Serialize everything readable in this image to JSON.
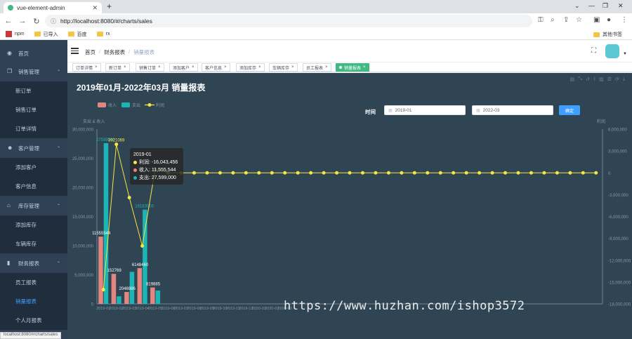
{
  "browser": {
    "tab_title": "vue-element-admin",
    "url": "http://localhost:8080/#/charts/sales",
    "status_url": "localhost:8080/#/charts/sales",
    "bookmarks": [
      "npm",
      "已导入",
      "百度",
      "rx"
    ],
    "other_bookmarks": "其他书签"
  },
  "sidebar": {
    "items": [
      {
        "label": "首页",
        "icon": "dashboard-icon",
        "type": "item"
      },
      {
        "label": "销售管理",
        "icon": "copy-icon",
        "type": "group"
      },
      {
        "label": "新订单",
        "type": "sub"
      },
      {
        "label": "销售订单",
        "type": "sub"
      },
      {
        "label": "订单详情",
        "type": "sub"
      },
      {
        "label": "客户管理",
        "icon": "people-icon",
        "type": "group"
      },
      {
        "label": "添加客户",
        "type": "sub"
      },
      {
        "label": "客户信息",
        "type": "sub"
      },
      {
        "label": "库存管理",
        "icon": "home-icon",
        "type": "group"
      },
      {
        "label": "添加库存",
        "type": "sub"
      },
      {
        "label": "车辆库存",
        "type": "sub"
      },
      {
        "label": "财务报表",
        "icon": "chart-icon",
        "type": "group"
      },
      {
        "label": "员工报表",
        "type": "sub"
      },
      {
        "label": "销量报表",
        "type": "sub",
        "active": true
      },
      {
        "label": "个人月报表",
        "type": "sub"
      }
    ]
  },
  "navbar": {
    "breadcrumb": [
      "首页",
      "财务报表",
      "销量报表"
    ]
  },
  "tags": [
    {
      "label": "订单详情",
      "active": false
    },
    {
      "label": "新订单",
      "active": false
    },
    {
      "label": "销售订单",
      "active": false
    },
    {
      "label": "添加客户",
      "active": false
    },
    {
      "label": "客户信息",
      "active": false
    },
    {
      "label": "添加库存",
      "active": false
    },
    {
      "label": "车辆库存",
      "active": false
    },
    {
      "label": "员工报表",
      "active": false
    },
    {
      "label": "销量报表",
      "active": true
    }
  ],
  "report": {
    "title": "2019年01月-2022年03月 销量报表",
    "filter_label": "时间",
    "start_date": "2019-01",
    "end_date": "2022-03",
    "confirm": "确定"
  },
  "tooltip": {
    "title": "2019-01",
    "lines": [
      "利润: -16,043,456",
      "收入: 11,555,544",
      "支出: 27,599,000"
    ]
  },
  "watermark": "https://www.huzhan.com/ishop3572",
  "colors": {
    "income": "#c23531",
    "income_bar": "#e3867f",
    "expense": "#1bb5b5",
    "profit": "#f7e544",
    "bg": "#2f4554"
  },
  "chart_data": {
    "type": "bar",
    "legend": [
      "收入",
      "支出",
      "利润"
    ],
    "ylabel_left": "支出 & 收入",
    "ylabel_right": "利润",
    "ylim_left": [
      0,
      30000000
    ],
    "ylim_right": [
      -18000000,
      6000000
    ],
    "left_ticks": [
      "0",
      "5,000,000",
      "10,000,000",
      "15,000,000",
      "20,000,000",
      "25,000,000",
      "30,000,000"
    ],
    "right_ticks": [
      "-18,000,000",
      "-15,000,000",
      "-12,000,000",
      "-9,000,000",
      "-6,000,000",
      "-3,000,000",
      "0",
      "3,000,000",
      "6,000,000"
    ],
    "categories": [
      "2019-01",
      "2019-02",
      "2019-03",
      "2019-04",
      "2019-05",
      "2019-06",
      "2019-07",
      "2019-08",
      "2019-09",
      "2019-10",
      "2019-11",
      "2019-12",
      "2020-01",
      "2020-02",
      "2020-03",
      "2020-04",
      "2020-05",
      "2020-06",
      "2020-07",
      "2020-08",
      "2020-09",
      "2020-10",
      "2020-11",
      "2020-12",
      "2021-01",
      "2021-02",
      "2021-03",
      "2021-04",
      "2021-05",
      "2021-06",
      "2021-07",
      "2021-08",
      "2021-09",
      "2021-10",
      "2021-11",
      "2021-12",
      "2022-01",
      "2022-02",
      "2022-03"
    ],
    "series": [
      {
        "name": "收入",
        "values": [
          11555544,
          5152769,
          2046986,
          6148460,
          2819885,
          0,
          0,
          0,
          0,
          0,
          0,
          0,
          0,
          0,
          0,
          0,
          0,
          0,
          0,
          0,
          0,
          0,
          0,
          0,
          0,
          0,
          0,
          0,
          0,
          0,
          0,
          0,
          0,
          0,
          0,
          0,
          0,
          0,
          0
        ]
      },
      {
        "name": "支出",
        "values": [
          27599000,
          1300000,
          5500000,
          16183000,
          2300000,
          0,
          0,
          0,
          0,
          0,
          0,
          0,
          0,
          0,
          0,
          0,
          0,
          0,
          0,
          0,
          0,
          0,
          0,
          0,
          0,
          0,
          0,
          0,
          0,
          0,
          0,
          0,
          0,
          0,
          0,
          0,
          0,
          0,
          0
        ]
      },
      {
        "name": "利润",
        "values": [
          -16043456,
          3921069,
          -3400000,
          -10034540,
          519885,
          0,
          0,
          0,
          0,
          0,
          0,
          0,
          0,
          0,
          0,
          0,
          0,
          0,
          0,
          0,
          0,
          0,
          0,
          0,
          0,
          0,
          0,
          0,
          0,
          0,
          0,
          0,
          0,
          0,
          0,
          0,
          0,
          0,
          0
        ]
      }
    ],
    "labels_income": [
      "11555544",
      "152769",
      "2046986",
      "6148460",
      "819885"
    ],
    "labels_expense": [
      "27599000",
      "",
      "",
      "16183000",
      ""
    ],
    "labels_profit": [
      "",
      "3921069",
      "",
      "",
      ""
    ]
  }
}
